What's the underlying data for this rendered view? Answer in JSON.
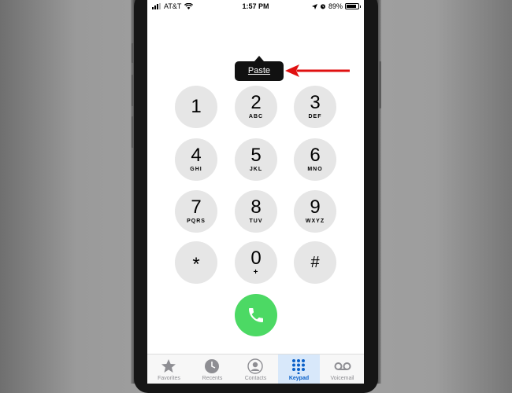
{
  "status_bar": {
    "carrier": "AT&T",
    "time": "1:57 PM",
    "battery": "89%",
    "battery_level": 0.89
  },
  "paste_menu": {
    "label": "Paste"
  },
  "keypad": {
    "keys": [
      {
        "digit": "1",
        "letters": ""
      },
      {
        "digit": "2",
        "letters": "ABC"
      },
      {
        "digit": "3",
        "letters": "DEF"
      },
      {
        "digit": "4",
        "letters": "GHI"
      },
      {
        "digit": "5",
        "letters": "JKL"
      },
      {
        "digit": "6",
        "letters": "MNO"
      },
      {
        "digit": "7",
        "letters": "PQRS"
      },
      {
        "digit": "8",
        "letters": "TUV"
      },
      {
        "digit": "9",
        "letters": "WXYZ"
      },
      {
        "digit": "*",
        "letters": ""
      },
      {
        "digit": "0",
        "letters": "+"
      },
      {
        "digit": "#",
        "letters": ""
      }
    ]
  },
  "tab_bar": {
    "tabs": [
      {
        "label": "Favorites",
        "icon": "star-icon"
      },
      {
        "label": "Recents",
        "icon": "clock-icon"
      },
      {
        "label": "Contacts",
        "icon": "contact-icon"
      },
      {
        "label": "Keypad",
        "icon": "keypad-icon",
        "active": true
      },
      {
        "label": "Voicemail",
        "icon": "voicemail-icon"
      }
    ]
  },
  "colors": {
    "call_green": "#4cd964",
    "active_tab_blue": "#0a60c9",
    "annotation_arrow": "#e01010"
  }
}
